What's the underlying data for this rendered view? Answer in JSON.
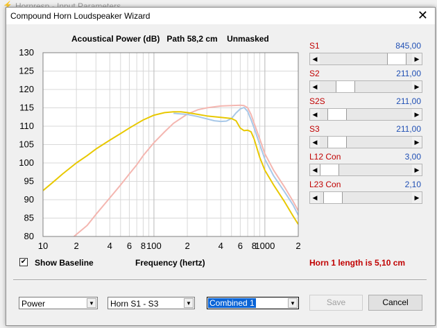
{
  "background_window": {
    "title": "Hornresp - Input Parameters"
  },
  "dialog": {
    "title": "Compound Horn Loudspeaker Wizard",
    "close_glyph": "✕"
  },
  "chart_header": {
    "text": "Acoustical Power (dB)   Path 58,2 cm    Unmasked"
  },
  "chart_data": {
    "type": "line",
    "title": "Acoustical Power (dB)   Path 58,2 cm    Unmasked",
    "xlabel": "Frequency (hertz)",
    "ylabel": "",
    "x_scale": "log",
    "xlim": [
      10,
      2000
    ],
    "ylim": [
      80,
      130
    ],
    "x_ticks": [
      10,
      20,
      40,
      60,
      80,
      100,
      200,
      400,
      600,
      800,
      1000,
      2000
    ],
    "x_tick_labels": [
      "10",
      "2",
      "4",
      "6",
      "8",
      "100",
      "2",
      "4",
      "6",
      "8",
      "1000",
      "2"
    ],
    "y_ticks": [
      80,
      85,
      90,
      95,
      100,
      105,
      110,
      115,
      120,
      125,
      130
    ],
    "grid": true,
    "series": [
      {
        "color": "#f4b6b0",
        "points": [
          [
            19,
            80
          ],
          [
            25,
            83
          ],
          [
            30,
            86
          ],
          [
            40,
            90.5
          ],
          [
            50,
            94
          ],
          [
            60,
            97
          ],
          [
            70,
            99.5
          ],
          [
            80,
            102
          ],
          [
            100,
            105.5
          ],
          [
            125,
            108.5
          ],
          [
            150,
            110.8
          ],
          [
            200,
            113.3
          ],
          [
            250,
            114.5
          ],
          [
            300,
            115
          ],
          [
            400,
            115.5
          ],
          [
            500,
            115.6
          ],
          [
            600,
            115.7
          ],
          [
            650,
            115.6
          ],
          [
            700,
            115
          ],
          [
            750,
            113.2
          ],
          [
            800,
            110.8
          ],
          [
            900,
            106.5
          ],
          [
            1000,
            102.5
          ],
          [
            1200,
            98
          ],
          [
            1500,
            93.5
          ],
          [
            1800,
            89.5
          ],
          [
            2000,
            87
          ]
        ]
      },
      {
        "color": "#a8c8e8",
        "points": [
          [
            150,
            113.5
          ],
          [
            200,
            113.2
          ],
          [
            250,
            112.6
          ],
          [
            300,
            112
          ],
          [
            350,
            111.5
          ],
          [
            400,
            111.3
          ],
          [
            450,
            111.4
          ],
          [
            500,
            112.1
          ],
          [
            550,
            113.6
          ],
          [
            600,
            114.7
          ],
          [
            650,
            115.1
          ],
          [
            700,
            114
          ],
          [
            750,
            111.8
          ],
          [
            800,
            109.5
          ],
          [
            900,
            105
          ],
          [
            1000,
            101
          ],
          [
            1200,
            96.5
          ],
          [
            1500,
            92.2
          ],
          [
            1800,
            88.5
          ],
          [
            2000,
            85.8
          ]
        ]
      },
      {
        "color": "#e8c800",
        "points": [
          [
            10,
            92.5
          ],
          [
            12,
            94.5
          ],
          [
            15,
            97
          ],
          [
            20,
            100
          ],
          [
            25,
            102
          ],
          [
            30,
            103.8
          ],
          [
            40,
            106.2
          ],
          [
            50,
            108
          ],
          [
            60,
            109.5
          ],
          [
            70,
            110.7
          ],
          [
            80,
            111.7
          ],
          [
            100,
            113
          ],
          [
            125,
            113.7
          ],
          [
            150,
            113.9
          ],
          [
            175,
            113.9
          ],
          [
            200,
            113.7
          ],
          [
            250,
            113.2
          ],
          [
            300,
            112.8
          ],
          [
            400,
            112.4
          ],
          [
            500,
            112.1
          ],
          [
            550,
            111.5
          ],
          [
            600,
            109.5
          ],
          [
            650,
            108.8
          ],
          [
            700,
            108.9
          ],
          [
            750,
            108.5
          ],
          [
            800,
            106.5
          ],
          [
            900,
            101.5
          ],
          [
            1000,
            98
          ],
          [
            1200,
            94
          ],
          [
            1500,
            89.5
          ],
          [
            1800,
            85.5
          ],
          [
            2000,
            83.3
          ]
        ]
      }
    ]
  },
  "sliders": [
    {
      "name": "S1",
      "value": "845,00",
      "position": 0.92
    },
    {
      "name": "S2",
      "value": "211,00",
      "position": 0.22
    },
    {
      "name": "S2S",
      "value": "211,00",
      "position": 0.1
    },
    {
      "name": "S3",
      "value": "211,00",
      "position": 0.1
    },
    {
      "name": "L12 Con",
      "value": "3,00",
      "position": 0.0
    },
    {
      "name": "L23 Con",
      "value": "2,10",
      "position": 0.05
    }
  ],
  "show_baseline": {
    "label": "Show Baseline",
    "checked": true,
    "check_glyph": "✔"
  },
  "x_axis_label": "Frequency (hertz)",
  "horn_length_text": "Horn 1 length is 5,10 cm",
  "dropdowns": [
    {
      "value": "Power"
    },
    {
      "value": "Horn S1 - S3"
    },
    {
      "value": "Combined 1"
    }
  ],
  "buttons": {
    "save": "Save",
    "cancel": "Cancel"
  },
  "colors": {
    "label_red": "#c00000",
    "value_blue": "#1f4fb4",
    "selection_blue": "#0a64d6"
  }
}
